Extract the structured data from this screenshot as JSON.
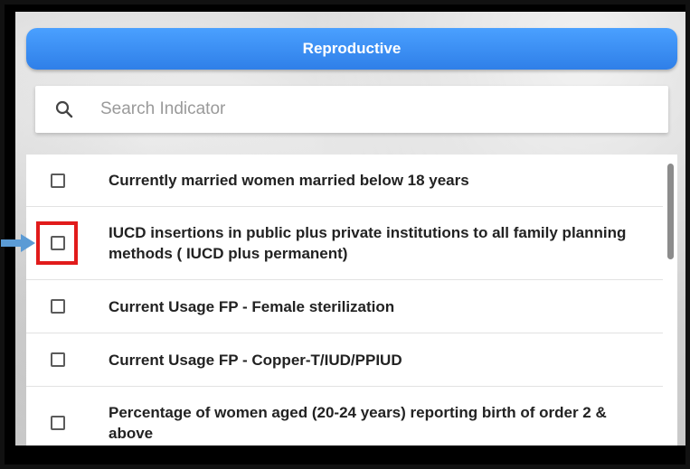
{
  "header": {
    "title": "Reproductive"
  },
  "search": {
    "placeholder": "Search Indicator",
    "value": ""
  },
  "indicators": [
    {
      "label": "Currently married women married below 18 years",
      "checked": false
    },
    {
      "label": "IUCD insertions in public plus private institutions to all family planning methods ( IUCD plus permanent)",
      "checked": false,
      "highlighted": true
    },
    {
      "label": "Current Usage FP - Female sterilization",
      "checked": false
    },
    {
      "label": "Current Usage FP - Copper-T/IUD/PPIUD",
      "checked": false
    },
    {
      "label": "Percentage of women aged (20-24 years) reporting birth of order 2 & above",
      "checked": false
    }
  ],
  "colors": {
    "accent": "#2f7fe8",
    "highlight": "#e11b1b",
    "arrow": "#5b9bd5"
  },
  "icons": {
    "search": "search-icon",
    "pointer": "arrow-right-icon"
  }
}
